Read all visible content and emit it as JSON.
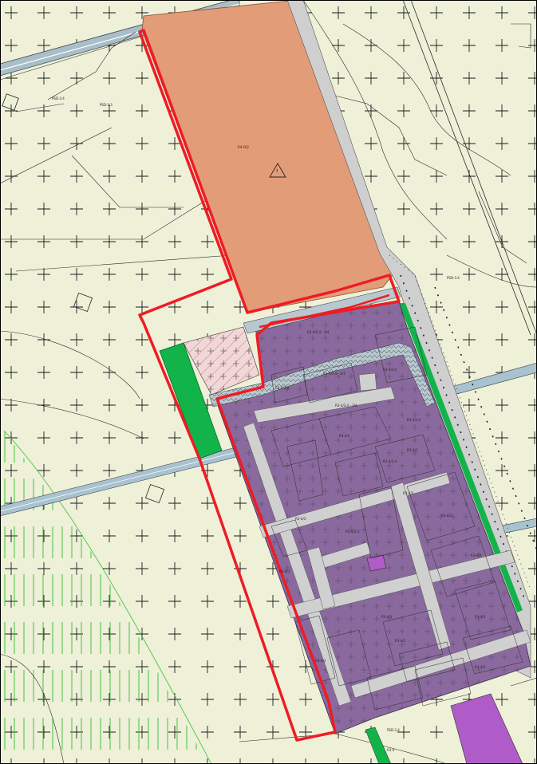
{
  "colors": {
    "agri_bg": "#eef0d8",
    "orange_zone": "#e39c78",
    "purple_zone": "#8a6a9e",
    "magenta_zone": "#b05cc8",
    "green_zone": "#12b44a",
    "road": "#d0d0d0",
    "hatched_zone": "#f0d8d8",
    "boundary_red": "#ee1c24",
    "rail_blue": "#9fb8c8",
    "line_black": "#2a2a2a"
  },
  "labels": {
    "orange_zone": "R4-O/2",
    "warning_symbol": "!",
    "warning_sub": "###",
    "top_left_1": "PSD-3.4",
    "top_left_2": "PSD-3.3",
    "right_top": "PSD-3.4",
    "bottom_mid": "PSD-3.4",
    "bottom_green": "R3-4",
    "purple_blocks": [
      "R3-4/3.4 - 3/4",
      "R3-4/3.4 - 3/3",
      "R3-4/3.4",
      "R3-4/3.4",
      "R3-4/3.4 - 3/4",
      "R3-4/3.4",
      "R3-4/3",
      "R3-4/3",
      "R3-4/3.4",
      "R3-4/3",
      "R3-4/3",
      "R3-4/3.4",
      "R3-4/3",
      "R3-4/3",
      "R3-4/3",
      "R3-4/3",
      "R3-4/3",
      "R3-4/3",
      "R3-4/3",
      "R3-4/3"
    ]
  }
}
